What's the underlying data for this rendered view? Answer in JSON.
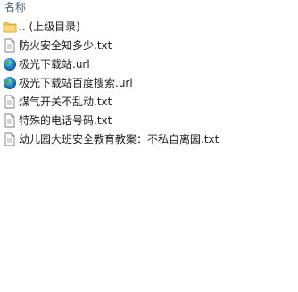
{
  "header": {
    "name_column": "名称"
  },
  "files": [
    {
      "name": ".. (上级目录)",
      "icon": "folder-icon"
    },
    {
      "name": "防火安全知多少.txt",
      "icon": "text-file-icon"
    },
    {
      "name": "极光下载站.url",
      "icon": "globe-link-icon"
    },
    {
      "name": "极光下载站百度搜索.url",
      "icon": "globe-link-icon"
    },
    {
      "name": "煤气开关不乱动.txt",
      "icon": "text-file-icon"
    },
    {
      "name": "特殊的电话号码.txt",
      "icon": "text-file-icon"
    },
    {
      "name": "幼儿园大班安全教育教案：不私自离园.txt",
      "icon": "text-file-icon"
    }
  ]
}
